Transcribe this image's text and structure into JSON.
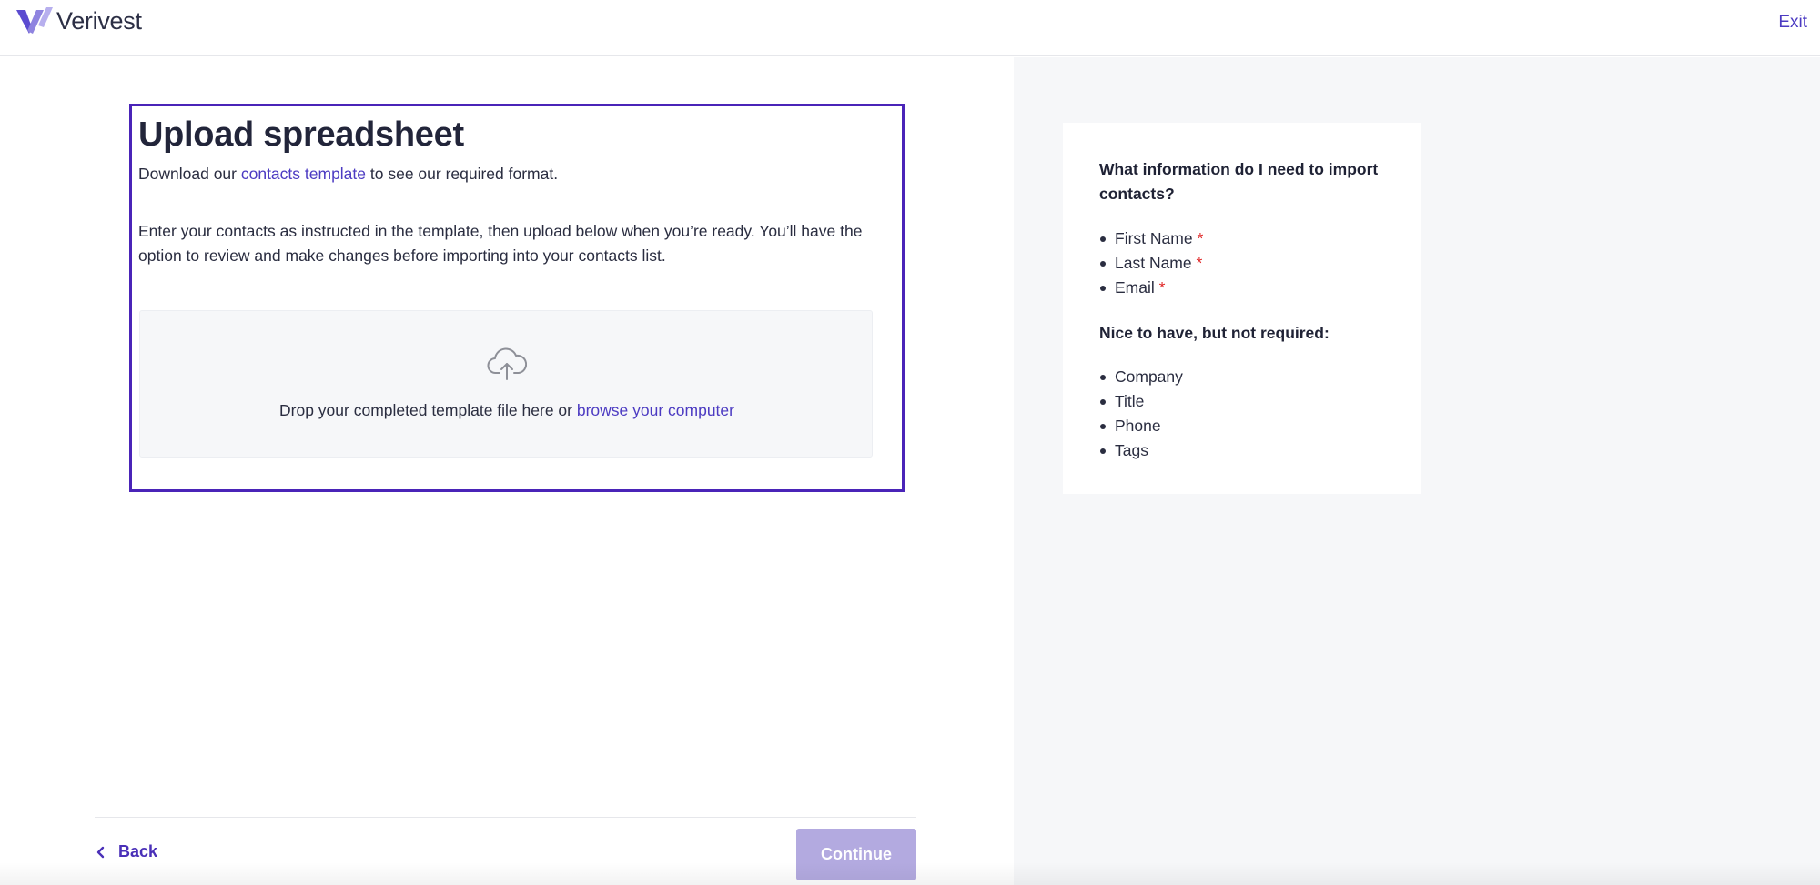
{
  "header": {
    "brand_name": "Verivest",
    "exit_label": "Exit"
  },
  "main": {
    "title": "Upload spreadsheet",
    "download_prefix": "Download our ",
    "template_link": "contacts template",
    "download_suffix": " to see our required format.",
    "instructions": "Enter your contacts as instructed in the template, then upload below when you’re ready. You’ll have the option to review and make changes before importing into your contacts list.",
    "dropzone": {
      "text_prefix": "Drop your completed template file here or ",
      "browse_link": "browse your computer"
    }
  },
  "info": {
    "title": "What information do I need to import contacts?",
    "required_items": [
      "First Name",
      "Last Name",
      "Email"
    ],
    "required_marker": "*",
    "optional_title": "Nice to have, but not required:",
    "optional_items": [
      "Company",
      "Title",
      "Phone",
      "Tags"
    ]
  },
  "footer": {
    "back_label": "Back",
    "continue_label": "Continue"
  },
  "colors": {
    "accent": "#4c3bc2",
    "focus_border": "#4a24b8",
    "continue_disabled": "#b3aae0",
    "required": "#e02828"
  }
}
